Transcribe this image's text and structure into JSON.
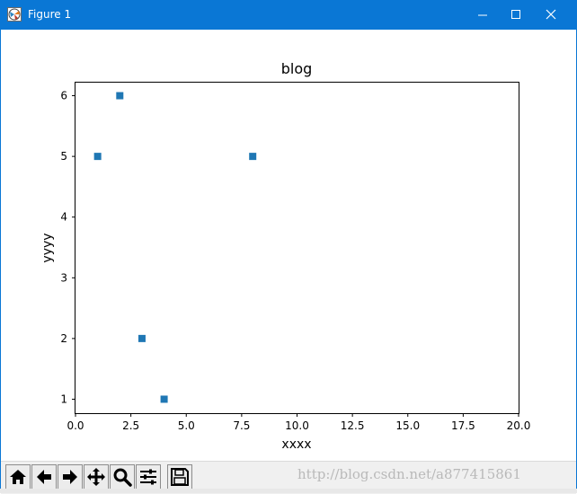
{
  "window": {
    "title": "Figure 1",
    "accent": "#0a77d5"
  },
  "window_controls": [
    "minimize-icon",
    "maximize-icon",
    "close-icon"
  ],
  "toolbar": {
    "buttons": [
      "home-icon",
      "back-icon",
      "forward-icon",
      "pan-icon",
      "zoom-icon",
      "subplots-icon",
      "save-icon"
    ]
  },
  "watermark": "http://blog.csdn.net/a877415861",
  "chart_data": {
    "type": "scatter",
    "title": "blog",
    "xlabel": "xxxx",
    "ylabel": "yyyy",
    "xlim": [
      0,
      20
    ],
    "ylim": [
      0.77,
      6.23
    ],
    "xticks": [
      0,
      2.5,
      5,
      7.5,
      10,
      12.5,
      15,
      17.5,
      20
    ],
    "xtick_labels": [
      "0.0",
      "2.5",
      "5.0",
      "7.5",
      "10.0",
      "12.5",
      "15.0",
      "17.5",
      "20.0"
    ],
    "yticks": [
      1,
      2,
      3,
      4,
      5,
      6
    ],
    "ytick_labels": [
      "1",
      "2",
      "3",
      "4",
      "5",
      "6"
    ],
    "grid": false,
    "marker": "square",
    "color": "#1f77b4",
    "points": [
      {
        "x": 1,
        "y": 5
      },
      {
        "x": 2,
        "y": 6
      },
      {
        "x": 3,
        "y": 2
      },
      {
        "x": 4,
        "y": 1
      },
      {
        "x": 8,
        "y": 5
      }
    ]
  }
}
